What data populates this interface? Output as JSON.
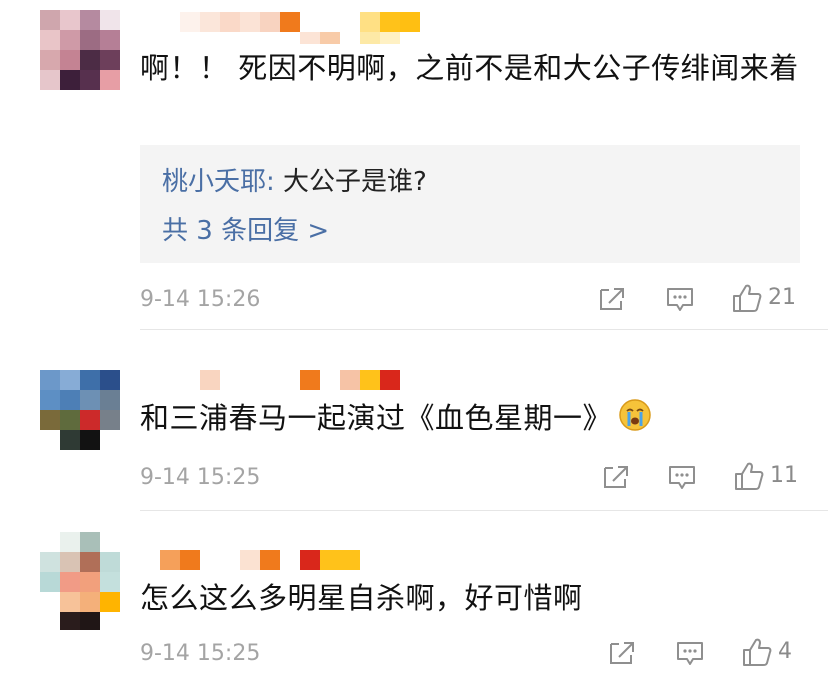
{
  "comments": [
    {
      "text": "啊！！ 死因不明啊，之前不是和大公子传绯闻来着",
      "reply": {
        "name": "桃小夭耶",
        "sep": ": ",
        "text": "大公子是谁?",
        "more": "共 3 条回复 >"
      },
      "time": "9-14 15:26",
      "likes": "21"
    },
    {
      "text": "和三浦春马一起演过《血色星期一》",
      "emoji": "crying-face",
      "time": "9-14 15:25",
      "likes": "11"
    },
    {
      "text": "怎么这么多明星自杀啊，好可惜啊",
      "time": "9-14 15:25",
      "likes": "4"
    }
  ],
  "icons": [
    "share-icon",
    "comment-icon",
    "like-icon"
  ],
  "colors": {
    "link": "#4a6fa5",
    "meta": "#a4a4a4",
    "reply_bg": "#f4f4f4"
  }
}
